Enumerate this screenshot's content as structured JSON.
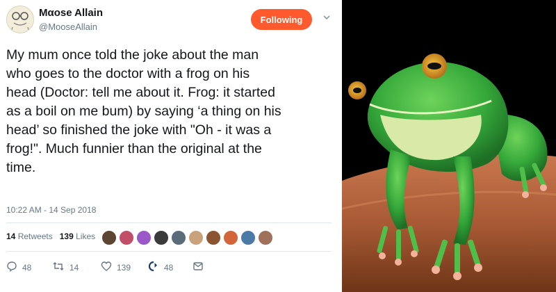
{
  "user": {
    "name": "Mαοse Allain",
    "handle": "@MooseAllain",
    "follow_label": "Following"
  },
  "tweet": {
    "lines": [
      "My mum once told the joke about the man",
      "who goes to the doctor with a frog on his",
      "head (Doctor: tell me about it. Frog: it started",
      "as a boil on me bum) by saying ‘a thing on his",
      "head’ so finished the joke with \"Oh - it was a",
      "frog!\".  Much funnier than the original at the",
      "time."
    ],
    "timestamp": "10:22 AM - 14 Sep 2018"
  },
  "stats": {
    "retweets_count": "14",
    "retweets_label": "Retweets",
    "likes_count": "139",
    "likes_label": "Likes"
  },
  "actions": {
    "replies": "48",
    "retweets": "14",
    "likes": "139",
    "moments": "48"
  },
  "colors": {
    "follow_button": "#ff5a2d",
    "muted_text": "#657786"
  },
  "icons": [
    "chevron-down-icon",
    "reply-icon",
    "retweet-icon",
    "like-icon",
    "moments-icon",
    "message-icon"
  ]
}
